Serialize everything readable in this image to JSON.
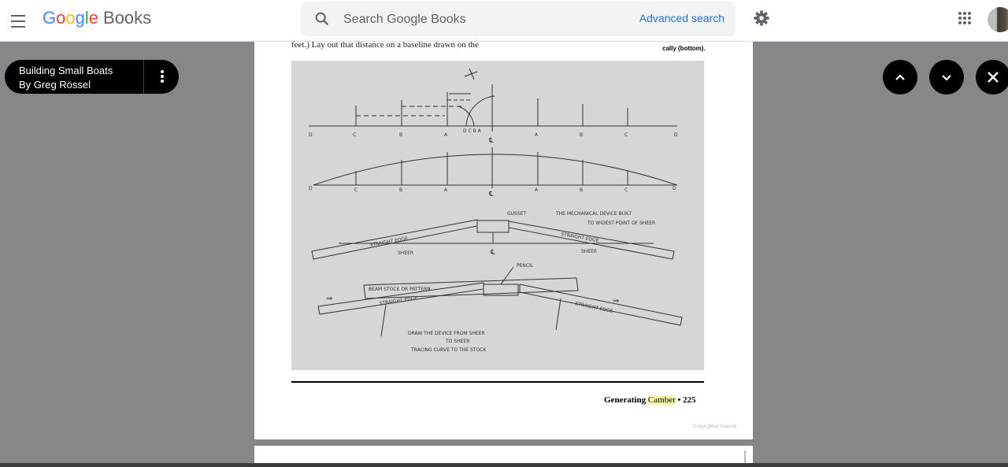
{
  "header": {
    "logo_text": "Google",
    "logo_books": "Books",
    "search_placeholder": "Search Google Books",
    "advanced_search": "Advanced search"
  },
  "book": {
    "title": "Building Small Boats",
    "author": "By Greg Rössel"
  },
  "page": {
    "body_text": "feet.) Lay out that distance on a baseline drawn on the",
    "caption": "cally (bottom).",
    "footer_title_prefix": "Generating ",
    "footer_highlight": "Camber",
    "footer_sep": "•",
    "page_number": "225",
    "copyright": "Copyrighted material"
  },
  "figure": {
    "labels_row1": [
      "D",
      "C",
      "B",
      "A",
      "D C B A",
      "A",
      "B",
      "C",
      "D"
    ],
    "centerline": "℄",
    "labels_row2": [
      "D",
      "C",
      "B",
      "A",
      "℄",
      "A",
      "B",
      "C",
      "D"
    ],
    "gusset": "GUSSET",
    "note1": "THE MECHANICAL DEVICE BUILT",
    "note2": "TO WIDEST POINT OF SHEER",
    "straight_edge_left": "STRAIGHT EDGE",
    "straight_edge_right": "STRAIGHT EDGE",
    "sheer_left": "SHEER",
    "sheer_right": "SHEER",
    "pencil": "PENCIL",
    "beam_stock": "BEAM STOCK OR PATTERN",
    "straight_edge_bottom_left": "STRAIGHT EDGE",
    "straight_edge_bottom_right": "STRAIGHT EDGE",
    "draw1": "DRAW THE DEVICE FROM SHEER",
    "draw2": "TO SHEER",
    "draw3": "TRACING CURVE TO THE STOCK"
  },
  "colors": {
    "accent": "#1a73e8",
    "highlight": "#f6f7a6"
  },
  "icons": [
    "menu-icon",
    "search-icon",
    "gear-icon",
    "apps-icon",
    "more-vert-icon",
    "chevron-up-icon",
    "chevron-down-icon",
    "close-icon"
  ]
}
